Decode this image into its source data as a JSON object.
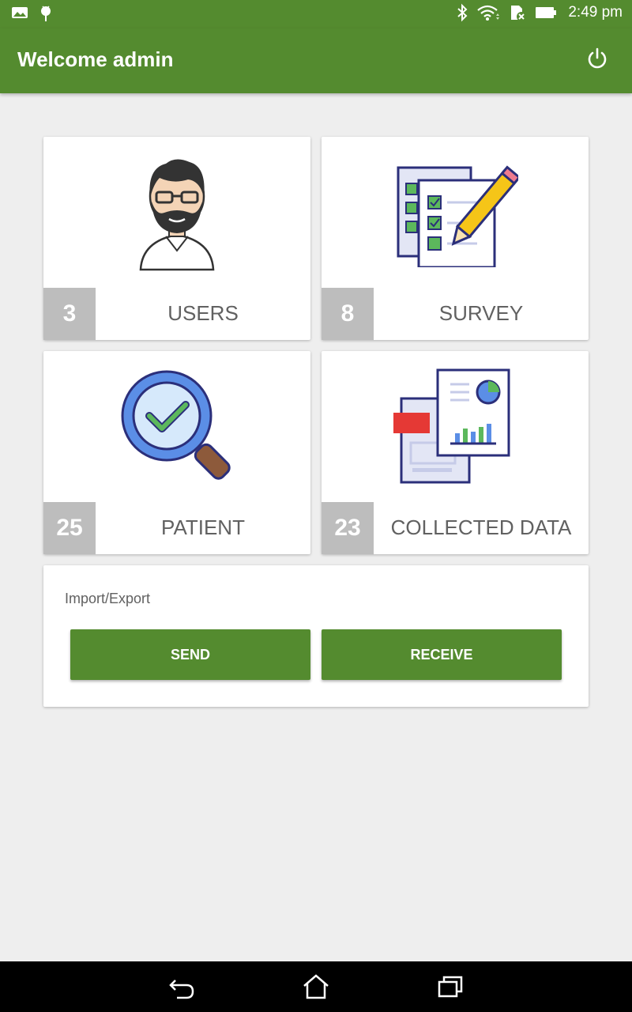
{
  "status_bar": {
    "time": "2:49 pm",
    "left_icons": [
      "gallery-icon",
      "android-debug-icon"
    ],
    "right_icons": [
      "bluetooth-icon",
      "wifi-icon",
      "sd-card-icon",
      "battery-icon"
    ]
  },
  "app_bar": {
    "title": "Welcome admin",
    "action_icon": "power-icon"
  },
  "tiles": [
    {
      "label": "USERS",
      "count": "3",
      "icon": "user-avatar-icon"
    },
    {
      "label": "SURVEY",
      "count": "8",
      "icon": "survey-checklist-icon"
    },
    {
      "label": "PATIENT",
      "count": "25",
      "icon": "magnifier-check-icon"
    },
    {
      "label": "COLLECTED DATA",
      "count": "23",
      "icon": "report-pdf-icon"
    }
  ],
  "import_export": {
    "title": "Import/Export",
    "send_label": "SEND",
    "receive_label": "RECEIVE"
  },
  "nav_bar": {
    "icons": [
      "back-icon",
      "home-icon",
      "recents-icon"
    ]
  },
  "colors": {
    "primary": "#548b2f",
    "background": "#eeeeee",
    "count_badge": "#bdbdbd"
  }
}
